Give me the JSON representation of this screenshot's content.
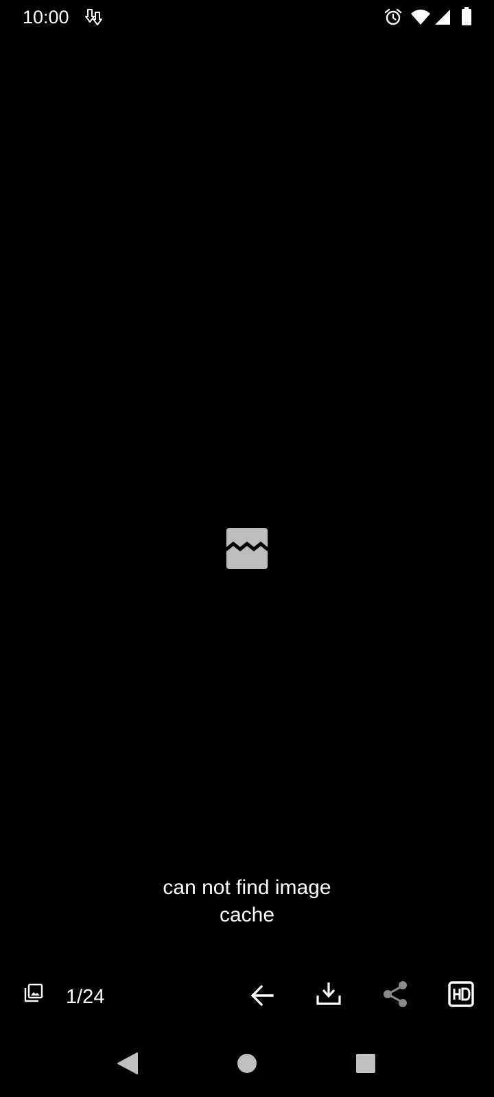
{
  "status_bar": {
    "time": "10:00",
    "icons": [
      "download-notification-icon",
      "alarm-icon",
      "wifi-icon",
      "signal-icon",
      "battery-icon"
    ]
  },
  "viewer": {
    "broken_image_icon": "broken-image-icon",
    "error_message": "can not find image\ncache"
  },
  "toolbar": {
    "gallery_icon": "gallery-icon",
    "page_counter": "1/24",
    "back_icon": "arrow-back-icon",
    "download_icon": "download-icon",
    "share_icon": "share-icon",
    "hd_icon": "hd-icon"
  },
  "nav_bar": {
    "buttons": [
      "nav-back-icon",
      "nav-home-icon",
      "nav-recents-icon"
    ]
  },
  "colors": {
    "background": "#000000",
    "foreground": "#ffffff",
    "broken_image": "#bdbdbd",
    "disabled_icon": "#8a8a8a",
    "nav_icon": "#bfbfbf"
  }
}
